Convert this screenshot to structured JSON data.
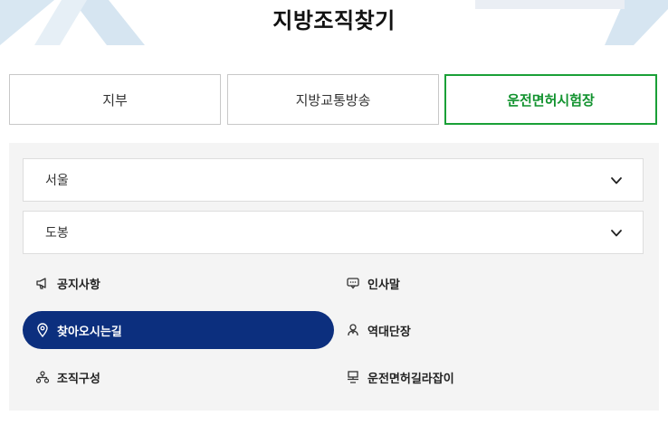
{
  "page": {
    "title": "지방조직찾기"
  },
  "tabs": [
    {
      "label": "지부"
    },
    {
      "label": "지방교통방송"
    },
    {
      "label": "운전면허시험장"
    }
  ],
  "selects": {
    "region": {
      "value": "서울"
    },
    "branch": {
      "value": "도봉"
    }
  },
  "menu": [
    {
      "label": "공지사항",
      "icon": "megaphone-icon"
    },
    {
      "label": "인사말",
      "icon": "speech-bubble-icon"
    },
    {
      "label": "찾아오시는길",
      "icon": "map-pin-icon"
    },
    {
      "label": "역대단장",
      "icon": "person-icon"
    },
    {
      "label": "조직구성",
      "icon": "org-chart-icon"
    },
    {
      "label": "운전면허길라잡이",
      "icon": "book-icon"
    }
  ],
  "colors": {
    "active_tab": "#1aa037",
    "active_menu_bg": "#0c2f7e",
    "panel_bg": "#f4f4f4"
  }
}
